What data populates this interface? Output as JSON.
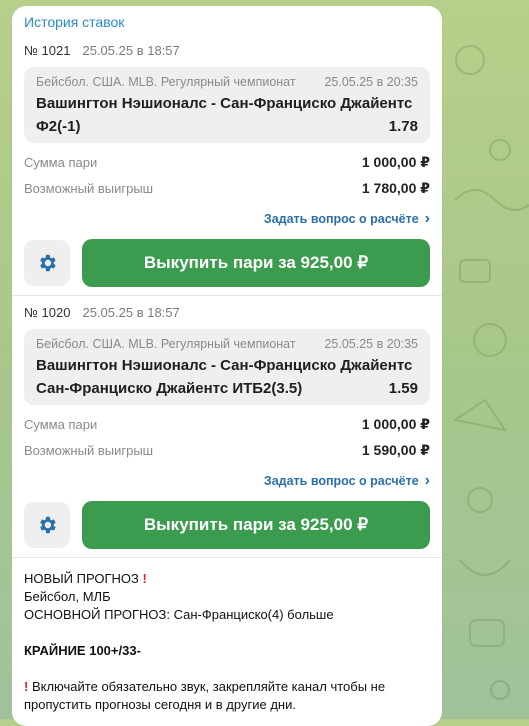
{
  "history_title": "История ставок",
  "bets": [
    {
      "number": "№ 1021",
      "placed_at": "25.05.25 в 18:57",
      "league": "Бейсбол. США. MLB. Регулярный чемпионат",
      "event_time": "25.05.25 в 20:35",
      "match": "Вашингтон Нэшионалс - Сан-Франциско Джайентс",
      "outcome": "Ф2(-1)",
      "odds": "1.78",
      "stake_label": "Сумма пари",
      "stake_value": "1 000,00 ₽",
      "win_label": "Возможный выигрыш",
      "win_value": "1 780,00 ₽",
      "ask_label": "Задать вопрос о расчёте",
      "buyout_label": "Выкупить пари за 925,00 ₽"
    },
    {
      "number": "№ 1020",
      "placed_at": "25.05.25 в 18:57",
      "league": "Бейсбол. США. MLB. Регулярный чемпионат",
      "event_time": "25.05.25 в 20:35",
      "match": "Вашингтон Нэшионалс - Сан-Франциско Джайентс",
      "outcome": "Сан-Франциско Джайентс ИТБ2(3.5)",
      "odds": "1.59",
      "stake_label": "Сумма пари",
      "stake_value": "1 000,00 ₽",
      "win_label": "Возможный выигрыш",
      "win_value": "1 590,00 ₽",
      "ask_label": "Задать вопрос о расчёте",
      "buyout_label": "Выкупить пари за 925,00 ₽"
    }
  ],
  "message": {
    "line1": "НОВЫЙ ПРОГНОЗ",
    "line2": "Бейсбол, МЛБ",
    "main_label": "ОСНОВНОЙ ПРОГНОЗ:",
    "main_value": "Сан-Франциско(4) больше",
    "extreme": "КРАЙНИЕ 100+/33-",
    "notice": "Включайте обязательно звук, закрепляйте канал чтобы не пропустить прогнозы сегодня и в другие дни."
  },
  "colors": {
    "accent_link": "#2a8ac8",
    "buy_button": "#3b9c4f",
    "background": "#a9c88a"
  }
}
